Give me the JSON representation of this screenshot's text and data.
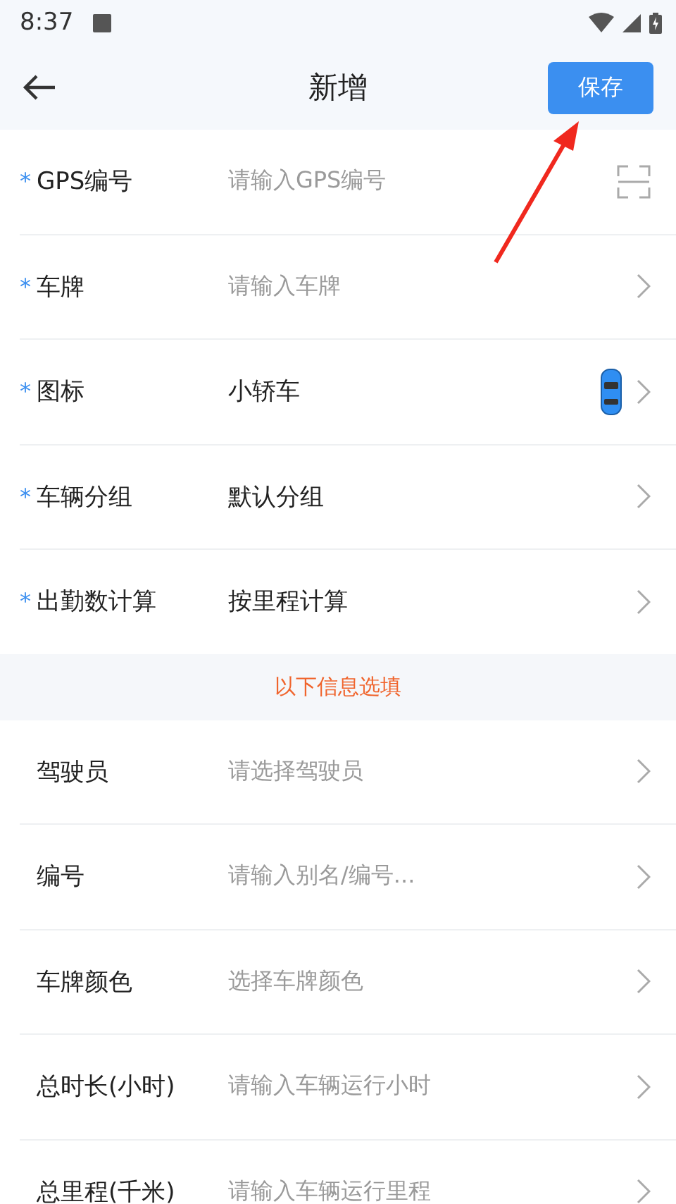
{
  "status_bar": {
    "time": "8:37"
  },
  "header": {
    "title": "新增",
    "action": "保存"
  },
  "required_fields": [
    {
      "label": "GPS编号",
      "required_mark": "*",
      "placeholder": "请输入GPS编号",
      "kind": "scan"
    },
    {
      "label": "车牌",
      "required_mark": "*",
      "placeholder": "请输入车牌",
      "kind": "select"
    },
    {
      "label": "图标",
      "required_mark": "*",
      "value": "小轿车",
      "kind": "icon-select"
    },
    {
      "label": "车辆分组",
      "required_mark": "*",
      "value": "默认分组",
      "kind": "select"
    },
    {
      "label": "出勤数计算",
      "required_mark": "*",
      "value": "按里程计算",
      "kind": "select"
    }
  ],
  "section_note": "以下信息选填",
  "optional_fields": [
    {
      "label": "驾驶员",
      "placeholder": "请选择驾驶员",
      "kind": "select"
    },
    {
      "label": "编号",
      "placeholder": "请输入别名/编号...",
      "kind": "select"
    },
    {
      "label": "车牌颜色",
      "placeholder": "选择车牌颜色",
      "kind": "select"
    },
    {
      "label": "总时长(小时)",
      "placeholder": "请输入车辆运行小时",
      "kind": "select"
    },
    {
      "label": "总里程(千米)",
      "placeholder": "请输入车辆运行里程",
      "kind": "select"
    }
  ]
}
